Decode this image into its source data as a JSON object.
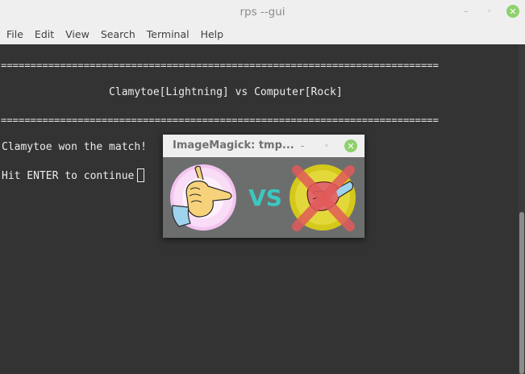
{
  "window": {
    "title": "rps --gui",
    "min_glyph": "–",
    "max_glyph": "◦",
    "close_glyph": "✕"
  },
  "menu": [
    "File",
    "Edit",
    "View",
    "Search",
    "Terminal",
    "Help"
  ],
  "terminal": {
    "separator_top": "==========================================================================",
    "matchup": "                 Clamytoe[Lightning] vs Computer[Rock]",
    "separator_bottom": "==========================================================================",
    "result": "Clamytoe won the match!",
    "prompt": "Hit ENTER to continue"
  },
  "image_window": {
    "title": "ImageMagick: tmp...",
    "min_glyph": "–",
    "max_glyph": "◦",
    "close_glyph": "✕",
    "vs_text": "VS"
  },
  "colors": {
    "terminal_bg": "#333333",
    "terminal_fg": "#ececec",
    "close_button": "#8ed16d",
    "vs_text": "#3cc7c0",
    "player_circle": "#f4c4f0",
    "computer_circle": "#d4c81a",
    "cross": "#e05a5a"
  }
}
